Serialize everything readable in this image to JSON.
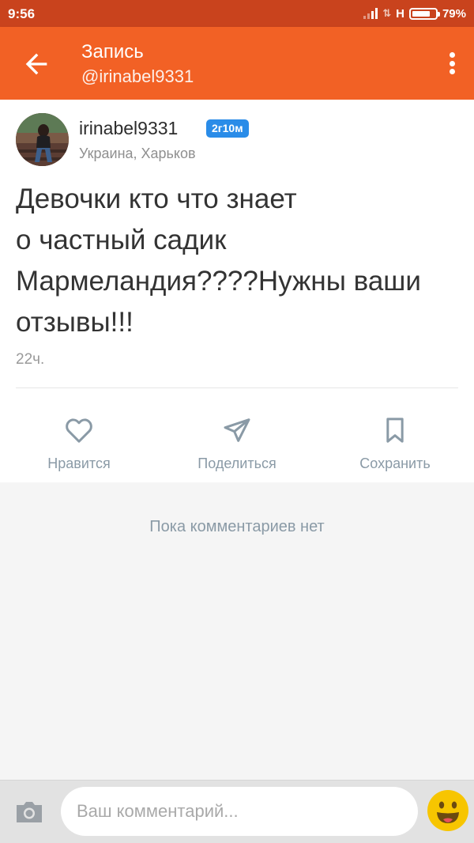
{
  "status": {
    "time": "9:56",
    "network": "H",
    "battery": "79%",
    "battery_level": 0.79
  },
  "header": {
    "title": "Запись",
    "subtitle": "@irinabel9331",
    "back_icon": "arrow-left-icon",
    "menu_icon": "more-vert-icon"
  },
  "post": {
    "username": "irinabel9331",
    "badge": "2г10м",
    "location": "Украина, Харьков",
    "text_lines": [
      "Девочки кто что знает",
      "о частный садик",
      "Мармеландия????Нужны ваши",
      "отзывы!!!"
    ],
    "time": "22ч."
  },
  "actions": {
    "like": {
      "label": "Нравится",
      "icon": "heart-icon"
    },
    "share": {
      "label": "Поделиться",
      "icon": "send-icon"
    },
    "save": {
      "label": "Сохранить",
      "icon": "bookmark-icon"
    }
  },
  "comments": {
    "empty_text": "Пока комментариев нет"
  },
  "comment_bar": {
    "placeholder": "Ваш комментарий...",
    "camera_icon": "camera-icon",
    "emoji_icon": "emoji-icon"
  },
  "colors": {
    "status_bar": "#c9431d",
    "app_bar": "#f26125",
    "badge": "#2a8ce8",
    "action_gray": "#8a9aa6",
    "emoji": "#f7c500"
  }
}
